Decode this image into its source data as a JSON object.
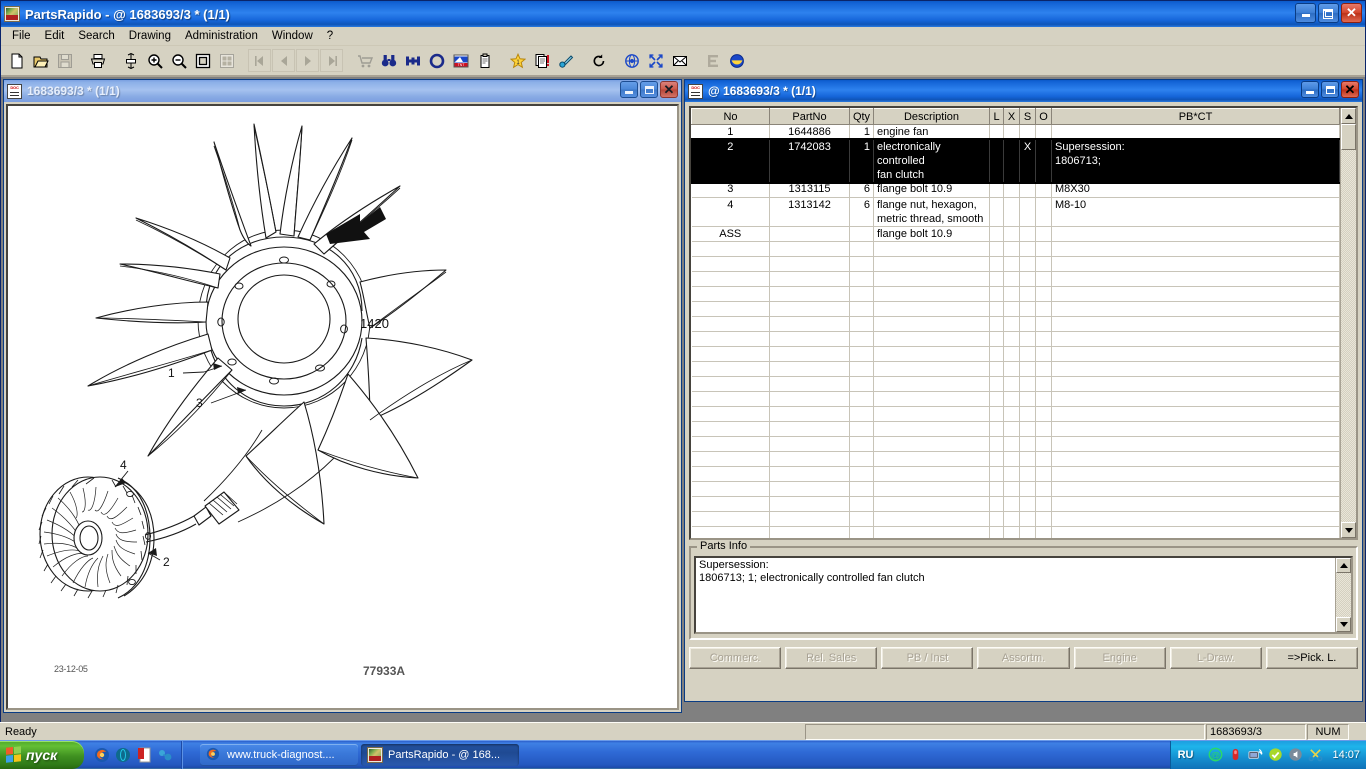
{
  "app": {
    "title": "PartsRapido - @ 1683693/3 * (1/1)",
    "icon": "partsrapido-app-icon",
    "window_buttons": {
      "minimize": "_",
      "restore": "❐",
      "close": "✕"
    }
  },
  "menu": {
    "items": [
      {
        "label": "File"
      },
      {
        "label": "Edit"
      },
      {
        "label": "Search"
      },
      {
        "label": "Drawing"
      },
      {
        "label": "Administration"
      },
      {
        "label": "Window"
      },
      {
        "label": "?"
      }
    ]
  },
  "toolbar": {
    "items": [
      {
        "name": "new-document-icon",
        "enabled": true
      },
      {
        "name": "open-folder-icon",
        "enabled": true
      },
      {
        "name": "save-disk-icon",
        "enabled": false
      },
      {
        "name": "separator"
      },
      {
        "name": "print-icon",
        "enabled": true
      },
      {
        "name": "separator"
      },
      {
        "name": "fit-height-icon",
        "enabled": true
      },
      {
        "name": "zoom-in-icon",
        "enabled": true
      },
      {
        "name": "zoom-out-icon",
        "enabled": true
      },
      {
        "name": "zoom-window-icon",
        "enabled": true
      },
      {
        "name": "thumbnails-icon",
        "enabled": false
      },
      {
        "name": "separator"
      },
      {
        "name": "first-page-icon",
        "enabled": false
      },
      {
        "name": "previous-page-icon",
        "enabled": false
      },
      {
        "name": "next-page-icon",
        "enabled": false
      },
      {
        "name": "last-page-icon",
        "enabled": false
      },
      {
        "name": "separator"
      },
      {
        "name": "shopping-cart-icon",
        "enabled": false
      },
      {
        "name": "binoculars-search-icon",
        "enabled": true
      },
      {
        "name": "chassis-icon",
        "enabled": true
      },
      {
        "name": "o-ring-icon",
        "enabled": true
      },
      {
        "name": "flag-tnt-icon",
        "enabled": true
      },
      {
        "name": "clipboard-icon",
        "enabled": true
      },
      {
        "name": "separator"
      },
      {
        "name": "favorites-star-icon",
        "enabled": true
      },
      {
        "name": "copy-notes-icon",
        "enabled": true
      },
      {
        "name": "pick-pen-icon",
        "enabled": true
      },
      {
        "name": "separator"
      },
      {
        "name": "refresh-icon",
        "enabled": true
      },
      {
        "name": "separator"
      },
      {
        "name": "globe-target-icon",
        "enabled": true
      },
      {
        "name": "expand-arrows-icon",
        "enabled": true
      },
      {
        "name": "mail-icon",
        "enabled": true
      },
      {
        "name": "separator"
      },
      {
        "name": "text-e-icon",
        "enabled": false
      },
      {
        "name": "smiley-icon",
        "enabled": true
      }
    ]
  },
  "drawing_window": {
    "title": "1683693/3 * (1/1)",
    "icon": "document-icon",
    "active": false,
    "drawing": {
      "date_label": "23-12-05",
      "code_label": "77933A",
      "callouts": [
        {
          "label": "1420"
        },
        {
          "label": "1"
        },
        {
          "label": "3"
        },
        {
          "label": "4"
        },
        {
          "label": "2"
        }
      ],
      "subject": "engine cooling fan with electronically controlled fan clutch"
    }
  },
  "parts_window": {
    "title": "@ 1683693/3 * (1/1)",
    "icon": "document-icon",
    "active": true,
    "grid": {
      "columns": [
        {
          "key": "no",
          "label": "No"
        },
        {
          "key": "part",
          "label": "PartNo"
        },
        {
          "key": "qty",
          "label": "Qty"
        },
        {
          "key": "desc",
          "label": "Description"
        },
        {
          "key": "l",
          "label": "L"
        },
        {
          "key": "x",
          "label": "X"
        },
        {
          "key": "s",
          "label": "S"
        },
        {
          "key": "o",
          "label": "O"
        },
        {
          "key": "pb",
          "label": "PB*CT"
        }
      ],
      "rows": [
        {
          "no": "1",
          "part": "1644886",
          "qty": "1",
          "desc": "engine fan",
          "l": "",
          "x": "",
          "s": "",
          "o": "",
          "pb": "",
          "selected": false
        },
        {
          "no": "2",
          "part": "1742083",
          "qty": "1",
          "desc": "electronically controlled\nfan clutch",
          "l": "",
          "x": "",
          "s": "X",
          "o": "",
          "pb": "Supersession:\n1806713;",
          "selected": true
        },
        {
          "no": "3",
          "part": "1313115",
          "qty": "6",
          "desc": "flange bolt 10.9",
          "l": "",
          "x": "",
          "s": "",
          "o": "",
          "pb": "M8X30",
          "selected": false
        },
        {
          "no": "4",
          "part": "1313142",
          "qty": "6",
          "desc": "flange nut, hexagon,\nmetric thread, smooth",
          "l": "",
          "x": "",
          "s": "",
          "o": "",
          "pb": "M8-10",
          "selected": false
        },
        {
          "no": "ASS",
          "part": "",
          "qty": "",
          "desc": "flange bolt 10.9",
          "l": "",
          "x": "",
          "s": "",
          "o": "",
          "pb": "",
          "selected": false
        }
      ],
      "empty_row_count": 21,
      "selection_color": "#000000"
    },
    "parts_info": {
      "legend": "Parts Info",
      "line1": "Supersession:",
      "line2": "1806713; 1; electronically controlled fan clutch"
    },
    "buttons": [
      {
        "label": "Commerc.",
        "enabled": false,
        "name": "commerc-button"
      },
      {
        "label": "Rel. Sales",
        "enabled": false,
        "name": "rel-sales-button"
      },
      {
        "label": "PB / Inst",
        "enabled": false,
        "name": "pb-inst-button"
      },
      {
        "label": "Assortm.",
        "enabled": false,
        "name": "assortm-button"
      },
      {
        "label": "Engine",
        "enabled": false,
        "name": "engine-button"
      },
      {
        "label": "L-Draw.",
        "enabled": false,
        "name": "l-draw-button"
      },
      {
        "label": "=>Pick. L.",
        "enabled": true,
        "name": "pick-list-button"
      }
    ]
  },
  "statusbar": {
    "ready": "Ready",
    "middle": "",
    "document": "1683693/3",
    "num": "NUM"
  },
  "taskbar": {
    "start_label": "пуск",
    "quicklaunch": [
      "firefox-icon",
      "opera-icon",
      "pdf-icon",
      "network-icon"
    ],
    "tasks": [
      {
        "label": "www.truck-diagnost....",
        "icon": "firefox-icon",
        "active": false
      },
      {
        "label": "PartsRapido - @ 168...",
        "icon": "partsrapido-app-icon",
        "active": true
      }
    ],
    "language": "RU",
    "tray": [
      "at-sign-icon",
      "usb-device-icon",
      "network-activity-icon",
      "shield-check-icon",
      "volume-icon",
      "scissors-icon"
    ],
    "clock": "14:07"
  },
  "colors": {
    "titlebar_active": "#2e82ee",
    "titlebar_inactive": "#a6c2ef",
    "face": "#d6d2c2",
    "taskbar": "#2f6ad6",
    "start_green": "#3f9020",
    "selection": "#000000",
    "close_red": "#d4462c"
  }
}
